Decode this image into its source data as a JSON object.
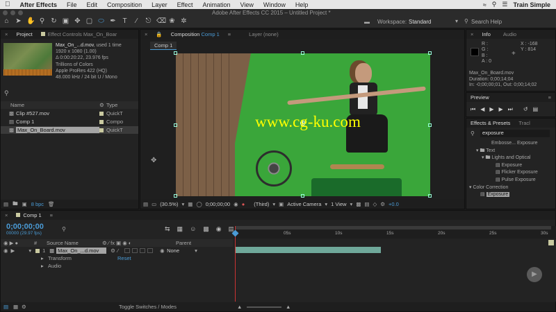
{
  "menubar": {
    "apple": "",
    "app_name": "After Effects",
    "items": [
      "File",
      "Edit",
      "Composition",
      "Layer",
      "Effect",
      "Animation",
      "View",
      "Window",
      "Help"
    ],
    "right_label": "Train Simple"
  },
  "toolbar": {
    "window_title": "Adobe After Effects CC 2015 – Untitled Project *",
    "workspace_label": "Workspace:",
    "workspace_value": "Standard",
    "search_help": "Search Help"
  },
  "project": {
    "tab": "Project",
    "effect_controls_tab": "Effect Controls Max_On_Boar",
    "asset_name": "Max_On_...d.mov",
    "used_times": ", used 1 time",
    "meta": [
      "1920 x 1080 (1.00)",
      "Δ 0:00:20:22, 23.976 fps",
      "Trillions of Colors",
      "Apple ProRes 422 (HQ)",
      "48.000 kHz / 24 bit U / Mono"
    ],
    "columns": {
      "name": "Name",
      "type": "Type"
    },
    "items": [
      {
        "name": "Clip #527.mov",
        "type": "QuickT"
      },
      {
        "name": "Comp 1",
        "type": "Compo"
      },
      {
        "name": "Max_On_Board.mov",
        "type": "QuickT"
      }
    ],
    "bpc": "8 bpc"
  },
  "composition": {
    "tab_prefix": "Composition",
    "tab_name": "Comp 1",
    "layer_tab": "Layer (none)",
    "subtab": "Comp 1",
    "watermark": "www.cg-ku.com",
    "zoom": "(30.5%)",
    "timecode": "0;00;00;00",
    "camera_view": "(Third)",
    "active_camera": "Active Camera",
    "view_count": "1 View",
    "exposure": "+0.0"
  },
  "info": {
    "tab": "Info",
    "audio_tab": "Audio",
    "rgba": [
      "R :",
      "G :",
      "B :",
      "A : 0"
    ],
    "x": "X : -168",
    "y": "Y : 814",
    "file": "Max_On_Board.mov",
    "duration": "Duration: 0;00;14;04",
    "inout": "In: -0;00;00;01, Out: 0;00;14;02"
  },
  "preview": {
    "tab": "Preview"
  },
  "effects": {
    "tab": "Effects & Presets",
    "tracker_tab": "Tracl",
    "search_value": "exposure",
    "items": [
      {
        "label": "Embosse... Exposure"
      },
      {
        "label": "Text"
      },
      {
        "label": "Lights and Optical"
      },
      {
        "label": "Exposure"
      },
      {
        "label": "Flicker Exposure"
      },
      {
        "label": "Pulse Exposure"
      },
      {
        "label": "Color Correction"
      },
      {
        "label": "Exposure"
      }
    ]
  },
  "timeline": {
    "tab": "Comp 1",
    "timecode": "0;00;00;00",
    "frames": "00000 (29.97 fps)",
    "columns": {
      "num": "#",
      "source": "Source Name",
      "parent": "Parent"
    },
    "layer": {
      "num": "1",
      "name": "Max_On_...d.mov",
      "parent": "None"
    },
    "props": [
      "Transform",
      "Audio"
    ],
    "reset": "Reset",
    "ruler": [
      "0s",
      "05s",
      "10s",
      "15s",
      "20s",
      "25s",
      "30s"
    ],
    "toggle_label": "Toggle Switches / Modes"
  },
  "colors": {
    "accent": "#4a9bd6",
    "green_screen": "#3aa63a",
    "layer_bar": "#6fa89a",
    "playhead": "#cc3333"
  }
}
